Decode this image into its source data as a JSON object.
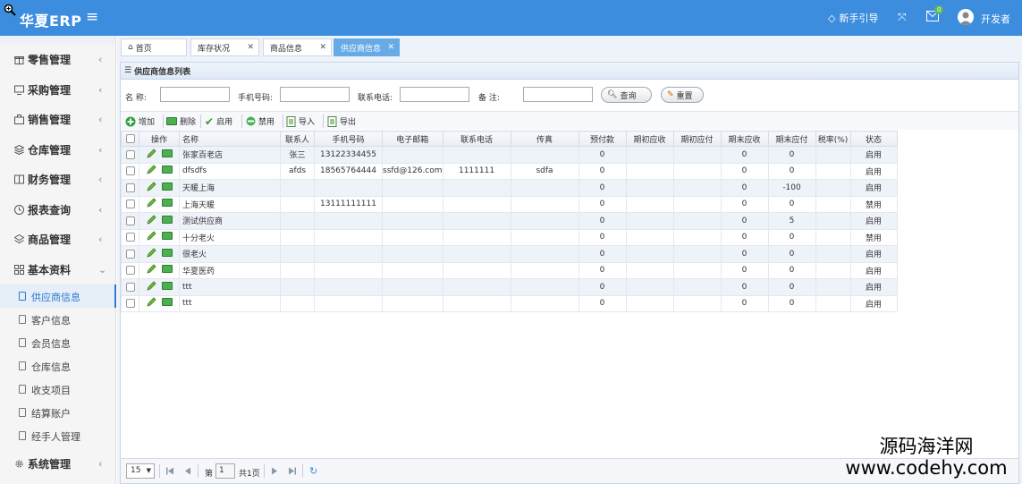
{
  "header": {
    "logo": "华夏ERP",
    "guide_label": "新手引导",
    "mail_badge": "0",
    "user_name": "开发者",
    "bg_color": "#3c8dde"
  },
  "sidebar": {
    "items": [
      {
        "label": "零售管理",
        "icon": "gift-icon"
      },
      {
        "label": "采购管理",
        "icon": "monitor-icon"
      },
      {
        "label": "销售管理",
        "icon": "briefcase-icon"
      },
      {
        "label": "仓库管理",
        "icon": "layers-icon"
      },
      {
        "label": "财务管理",
        "icon": "book-icon"
      },
      {
        "label": "报表查询",
        "icon": "clock-icon"
      },
      {
        "label": "商品管理",
        "icon": "stack-icon"
      },
      {
        "label": "基本资料",
        "icon": "grid-icon"
      },
      {
        "label": "系统管理",
        "icon": "gear-icon"
      }
    ],
    "submenu": [
      {
        "label": "供应商信息",
        "active": true
      },
      {
        "label": "客户信息"
      },
      {
        "label": "会员信息"
      },
      {
        "label": "仓库信息"
      },
      {
        "label": "收支项目"
      },
      {
        "label": "结算账户"
      },
      {
        "label": "经手人管理"
      }
    ]
  },
  "tabs": [
    {
      "label": "首页",
      "icon": "home-icon"
    },
    {
      "label": "库存状况"
    },
    {
      "label": "商品信息"
    },
    {
      "label": "供应商信息",
      "active": true
    }
  ],
  "panel": {
    "title": "供应商信息列表"
  },
  "search": {
    "name_label": "名 称:",
    "phone_label": "手机号码:",
    "tel_label": "联系电话:",
    "remark_label": "备 注:",
    "query_button": "查询",
    "reset_button": "重置"
  },
  "toolbar": {
    "add": "增加",
    "delete": "删除",
    "enable": "启用",
    "disable": "禁用",
    "import": "导入",
    "export": "导出"
  },
  "grid": {
    "columns": [
      "操作",
      "名称",
      "联系人",
      "手机号码",
      "电子邮箱",
      "联系电话",
      "传真",
      "预付款",
      "期初应收",
      "期初应付",
      "期末应收",
      "期末应付",
      "税率(%)",
      "状态"
    ],
    "rows": [
      [
        "张家百老店",
        "张三",
        "13122334455",
        "",
        "",
        "",
        "0",
        "",
        "",
        "0",
        "0",
        "",
        "启用"
      ],
      [
        "dfsdfs",
        "afds",
        "18565764444",
        "ssfd@126.com",
        "1111111",
        "sdfa",
        "0",
        "",
        "",
        "0",
        "0",
        "",
        "启用"
      ],
      [
        "天暖上海",
        "",
        "",
        "",
        "",
        "",
        "0",
        "",
        "",
        "0",
        "-100",
        "",
        "启用"
      ],
      [
        "上海天暖",
        "",
        "13111111111",
        "",
        "",
        "",
        "0",
        "",
        "",
        "0",
        "0",
        "",
        "禁用"
      ],
      [
        "测试供应商",
        "",
        "",
        "",
        "",
        "",
        "0",
        "",
        "",
        "0",
        "5",
        "",
        "启用"
      ],
      [
        "十分老火",
        "",
        "",
        "",
        "",
        "",
        "0",
        "",
        "",
        "0",
        "0",
        "",
        "禁用"
      ],
      [
        "很老火",
        "",
        "",
        "",
        "",
        "",
        "0",
        "",
        "",
        "0",
        "0",
        "",
        "启用"
      ],
      [
        "华夏医药",
        "",
        "",
        "",
        "",
        "",
        "0",
        "",
        "",
        "0",
        "0",
        "",
        "启用"
      ],
      [
        "ttt",
        "",
        "",
        "",
        "",
        "",
        "0",
        "",
        "",
        "0",
        "0",
        "",
        "启用"
      ],
      [
        "ttt",
        "",
        "",
        "",
        "",
        "",
        "0",
        "",
        "",
        "0",
        "0",
        "",
        "启用"
      ]
    ]
  },
  "pager": {
    "page_size": "15",
    "page_prefix": "第",
    "page_value": "1",
    "page_total": "共1页"
  },
  "watermark": {
    "line1": "源码海洋网",
    "line2": "www.codehy.com"
  }
}
